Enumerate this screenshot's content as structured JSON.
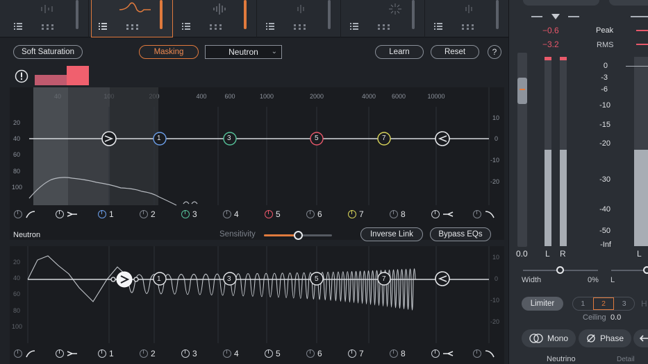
{
  "modules": [
    {
      "id": "m1",
      "active": false
    },
    {
      "id": "m2",
      "active": true
    },
    {
      "id": "m3",
      "active": false
    },
    {
      "id": "m4",
      "active": false
    },
    {
      "id": "m5",
      "active": false
    },
    {
      "id": "m6",
      "active": false
    }
  ],
  "toolbar": {
    "soft_saturation": "Soft Saturation",
    "masking": "Masking",
    "preset": "Neutron",
    "learn": "Learn",
    "reset": "Reset",
    "help": "?"
  },
  "top_eq": {
    "freq_labels": [
      "40",
      "100",
      "200",
      "400",
      "600",
      "1000",
      "2000",
      "4000",
      "6000",
      "10000"
    ],
    "left_scale": [
      "20",
      "40",
      "60",
      "80",
      "100"
    ],
    "right_scale": [
      "10",
      "0",
      "-10",
      "-20"
    ],
    "nodes": [
      "1",
      "3",
      "5",
      "7"
    ]
  },
  "bands": [
    "1",
    "2",
    "3",
    "4",
    "5",
    "6",
    "7",
    "8"
  ],
  "bottom": {
    "title": "Neutron",
    "sensitivity_label": "Sensitivity",
    "inverse_link": "Inverse Link",
    "bypass_eqs": "Bypass EQs",
    "left_scale": [
      "20",
      "40",
      "60",
      "80",
      "100"
    ],
    "right_scale": [
      "10",
      "0",
      "-10",
      "-20"
    ],
    "nodes": [
      "1",
      "3",
      "5",
      "7"
    ]
  },
  "meters": {
    "peak_l": "−0.6",
    "rms_l": "−3.2",
    "peak_label": "Peak",
    "rms_label": "RMS",
    "scale": [
      "0",
      "-3",
      "-6",
      "-10",
      "-15",
      "-20",
      "-30",
      "-40",
      "-50",
      "-Inf"
    ],
    "gain_value": "0.0",
    "l_label": "L",
    "r_label": "R",
    "l2_label": "L",
    "width_label": "Width",
    "width_value": "0%",
    "width2_label": "L",
    "limiter": "Limiter",
    "ceiling_modes": [
      "1",
      "2",
      "3"
    ],
    "ceiling_label": "Ceiling",
    "ceiling_value": "0.0",
    "mono": "Mono",
    "phase": "Phase",
    "footer_left": "Neutrino",
    "footer_right": "Detail"
  }
}
